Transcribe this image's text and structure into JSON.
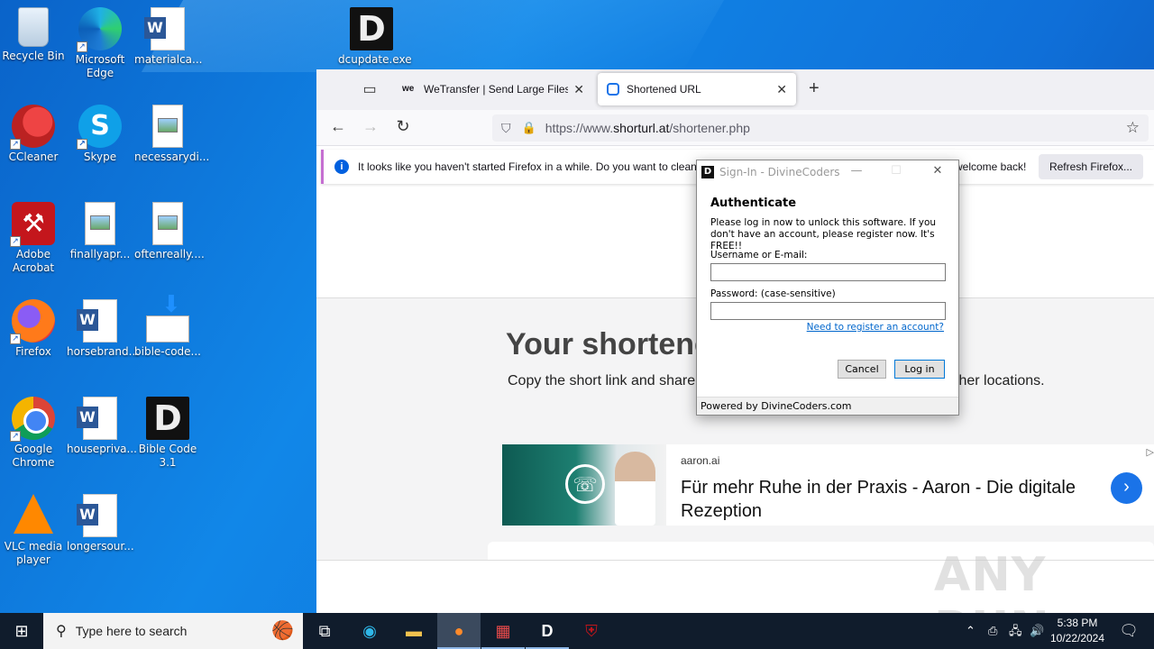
{
  "desktop": {
    "icons": [
      {
        "label": "Recycle Bin"
      },
      {
        "label": "Microsoft Edge"
      },
      {
        "label": "materialca..."
      },
      {
        "label": "dcupdate.exe"
      },
      {
        "label": "CCleaner"
      },
      {
        "label": "Skype"
      },
      {
        "label": "necessarydi..."
      },
      {
        "label": "Adobe Acrobat"
      },
      {
        "label": "finallyapr..."
      },
      {
        "label": "oftenreally...."
      },
      {
        "label": "Firefox"
      },
      {
        "label": "horsebrand..."
      },
      {
        "label": "bible-code..."
      },
      {
        "label": "Google Chrome"
      },
      {
        "label": "housepriva..."
      },
      {
        "label": "Bible Code 3.1"
      },
      {
        "label": "VLC media player"
      },
      {
        "label": "longersour..."
      }
    ],
    "watermark": "ANY RUN"
  },
  "browser": {
    "tabs": [
      {
        "label": "WeTransfer | Send Large Files Fa",
        "favicon": "we"
      },
      {
        "label": "Shortened URL",
        "favicon": "shorturl"
      }
    ],
    "url": {
      "scheme": "https://www.",
      "host": "shorturl.at",
      "path": "/shortener.php"
    },
    "notice": {
      "text": "It looks like you haven't started Firefox in a while. Do you want to clean",
      "tail": "welcome back!",
      "button": "Refresh Firefox..."
    },
    "page": {
      "heading": "Your shortened",
      "sub": "Copy the short link and share i",
      "sub_tail": "ther locations."
    },
    "ad": {
      "domain": "aaron.ai",
      "title": "Für mehr Ruhe in der Praxis - Aaron - Die digitale Rezeption"
    }
  },
  "dialog": {
    "title": "Sign-In - DivineCoders",
    "heading": "Authenticate",
    "message": "Please log in now to unlock this software. If you don't have an account, please register now. It's FREE!!",
    "username_label": "Username or E-mail:",
    "password_label": "Password: (case-sensitive)",
    "register_link": "Need to register an account?",
    "cancel": "Cancel",
    "login": "Log in",
    "footer": "Powered by DivineCoders.com"
  },
  "taskbar": {
    "search_placeholder": "Type here to search",
    "time": "5:38 PM",
    "date": "10/22/2024"
  }
}
